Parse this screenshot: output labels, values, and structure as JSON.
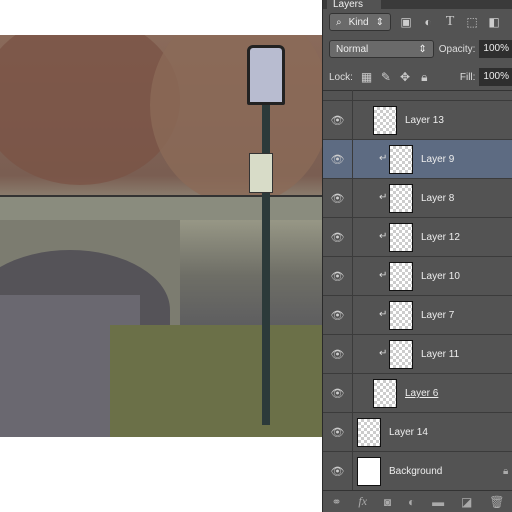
{
  "panel": {
    "tab": "Layers",
    "filter_kind": "Kind",
    "blend_mode": "Normal",
    "opacity_label": "Opacity:",
    "opacity": "100%",
    "lock_label": "Lock:",
    "fill_label": "Fill:",
    "fill": "100%"
  },
  "layers": [
    {
      "name": "Layer 13",
      "clipped": false,
      "indent": true,
      "selected": false,
      "thumb": "transparent"
    },
    {
      "name": "Layer 9",
      "clipped": true,
      "indent": true,
      "selected": true,
      "thumb": "transparent"
    },
    {
      "name": "Layer 8",
      "clipped": true,
      "indent": true,
      "selected": false,
      "thumb": "transparent"
    },
    {
      "name": "Layer 12",
      "clipped": true,
      "indent": true,
      "selected": false,
      "thumb": "transparent"
    },
    {
      "name": "Layer 10",
      "clipped": true,
      "indent": true,
      "selected": false,
      "thumb": "transparent"
    },
    {
      "name": "Layer 7",
      "clipped": true,
      "indent": true,
      "selected": false,
      "thumb": "transparent"
    },
    {
      "name": "Layer 11",
      "clipped": true,
      "indent": true,
      "selected": false,
      "thumb": "transparent"
    },
    {
      "name": "Layer 6",
      "clipped": false,
      "indent": true,
      "selected": false,
      "thumb": "transparent",
      "underlined": true
    },
    {
      "name": "Layer 14",
      "clipped": false,
      "indent": false,
      "selected": false,
      "thumb": "transparent"
    },
    {
      "name": "Background",
      "clipped": false,
      "indent": false,
      "selected": false,
      "thumb": "white",
      "locked": true
    }
  ],
  "colors": {
    "panel": "#535353",
    "selected": "#5d6b82"
  }
}
